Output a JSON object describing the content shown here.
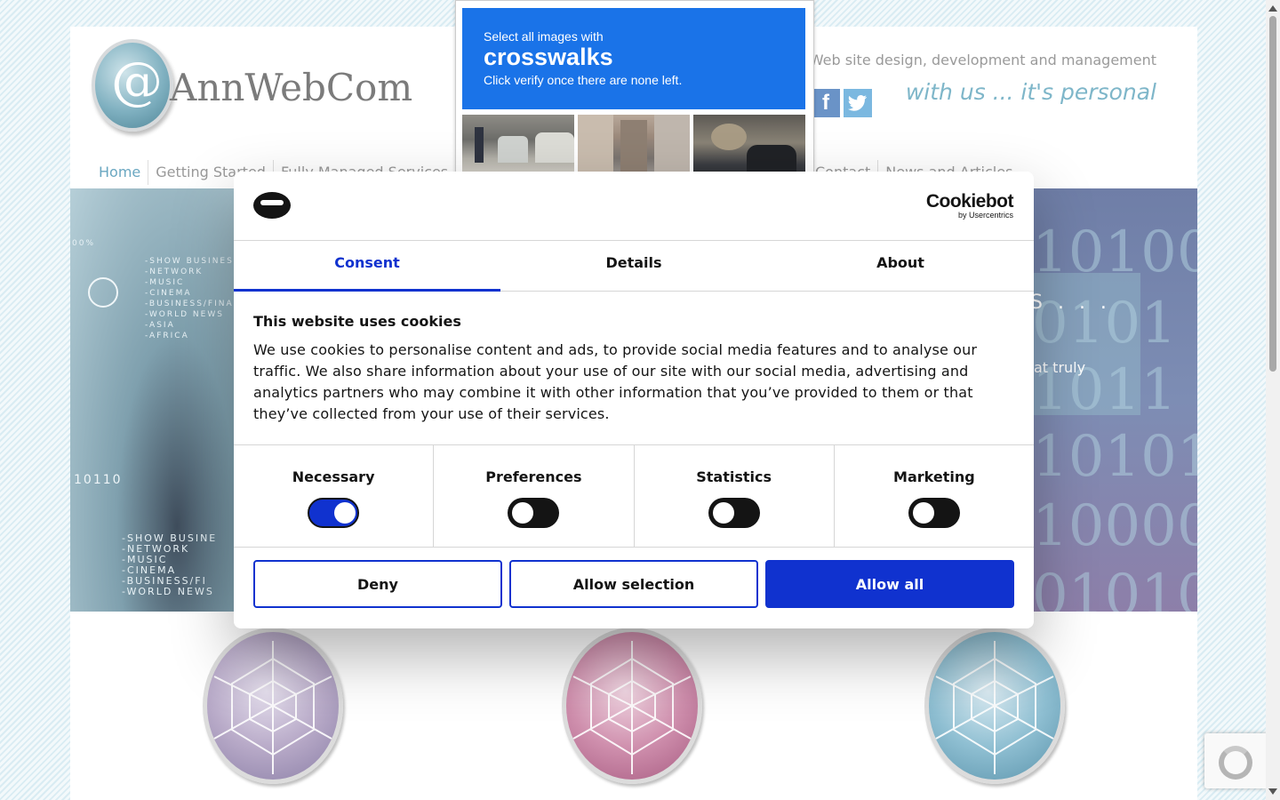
{
  "site": {
    "logo_text": "AnnWebCom",
    "logo_glyph": "@",
    "tagline": "Web site design, development and management",
    "motto": "with us ... it's personal",
    "social": {
      "facebook": "f",
      "twitter": "t"
    },
    "nav_left": [
      "Home",
      "Getting Started",
      "Fully Managed Services"
    ],
    "nav_right": [
      "Contact",
      "News and Articles"
    ]
  },
  "hero": {
    "heading_fragment": "S . . .",
    "subtext_fragment": "at truly",
    "binary_lines": [
      "101001",
      "0101",
      "1011",
      "10101",
      "100000",
      "0101000"
    ],
    "small_left": "-SHOW BUSINESS\n-NETWORK\n-MUSIC\n-CINEMA\n-BUSINESS/FINAN\n-WORLD NEWS\n-ASIA\n-AFRICA",
    "small_left_2": "-SHOW BUSINE\n-NETWORK\n-MUSIC\n-CINEMA\n-BUSINESS/FI\n-WORLD NEWS",
    "percent": "00%",
    "number": "10110"
  },
  "captcha": {
    "line1": "Select all images with",
    "line2": "crosswalks",
    "line3": "Click verify once there are none left."
  },
  "cookie_dialog": {
    "brand": "Cookiebot",
    "brand_sub": "by Usercentrics",
    "tabs": [
      "Consent",
      "Details",
      "About"
    ],
    "active_tab": "Consent",
    "title": "This website uses cookies",
    "body": "We use cookies to personalise content and ads, to provide social media features and to analyse our traffic. We also share information about your use of our site with our social media, advertising and analytics partners who may combine it with other information that you’ve provided to them or that they’ve collected from your use of their services.",
    "categories": [
      {
        "label": "Necessary",
        "checked": true
      },
      {
        "label": "Preferences",
        "checked": false
      },
      {
        "label": "Statistics",
        "checked": false
      },
      {
        "label": "Marketing",
        "checked": false
      }
    ],
    "buttons": {
      "deny": "Deny",
      "allow_selection": "Allow selection",
      "allow_all": "Allow all"
    },
    "accent_color": "#1032cf"
  }
}
